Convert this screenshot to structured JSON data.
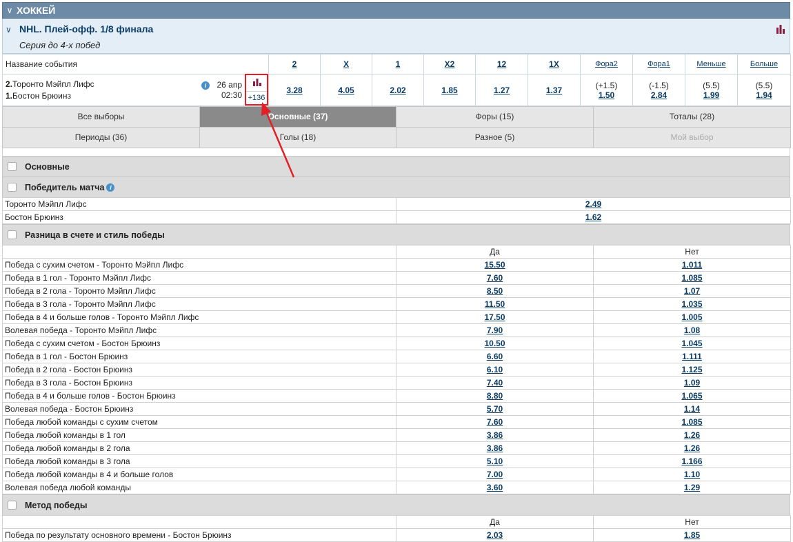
{
  "sport": {
    "title": "ХОККЕЙ"
  },
  "league": {
    "title": "NHL. Плей-офф. 1/8 финала",
    "subtitle": "Серия до 4-х побед"
  },
  "odds_header": {
    "name_label": "Название события",
    "columns": [
      "2",
      "X",
      "1",
      "X2",
      "12",
      "1X",
      "Фора2",
      "Фора1",
      "Меньше",
      "Больше"
    ]
  },
  "event": {
    "team1": "Торонто Мэйпл Лифс",
    "team1_num": "2.",
    "team2": "Бостон Брюинз",
    "team2_num": "1.",
    "date": "26 апр",
    "time": "02:30",
    "more_markets": "+136",
    "odds": [
      "3.28",
      "4.05",
      "2.02",
      "1.85",
      "1.27",
      "1.37"
    ],
    "fora2": {
      "line": "(+1.5)",
      "odd": "1.50"
    },
    "fora1": {
      "line": "(-1.5)",
      "odd": "2.84"
    },
    "under": {
      "line": "(5.5)",
      "odd": "1.99"
    },
    "over": {
      "line": "(5.5)",
      "odd": "1.94"
    }
  },
  "tabs": [
    {
      "label": "Все выборы",
      "state": "normal"
    },
    {
      "label": "Основные (37)",
      "state": "active"
    },
    {
      "label": "Форы (15)",
      "state": "normal"
    },
    {
      "label": "Тоталы (28)",
      "state": "normal"
    },
    {
      "label": "Периоды (36)",
      "state": "normal"
    },
    {
      "label": "Голы (18)",
      "state": "normal"
    },
    {
      "label": "Разное (5)",
      "state": "normal"
    },
    {
      "label": "Мой выбор",
      "state": "disabled"
    }
  ],
  "sections": {
    "main": "Основные",
    "winner": {
      "title": "Победитель матча",
      "rows": [
        {
          "name": "Торонто Мэйпл Лифс",
          "odd": "2.49"
        },
        {
          "name": "Бостон Брюинз",
          "odd": "1.62"
        }
      ]
    },
    "margin": {
      "title": "Разница в счете и стиль победы",
      "col_yes": "Да",
      "col_no": "Нет",
      "rows": [
        {
          "name": "Победа с сухим счетом - Торонто Мэйпл Лифс",
          "yes": "15.50",
          "no": "1.011"
        },
        {
          "name": "Победа в 1 гол - Торонто Мэйпл Лифс",
          "yes": "7.60",
          "no": "1.085"
        },
        {
          "name": "Победа в 2 гола - Торонто Мэйпл Лифс",
          "yes": "8.50",
          "no": "1.07"
        },
        {
          "name": "Победа в 3 гола - Торонто Мэйпл Лифс",
          "yes": "11.50",
          "no": "1.035"
        },
        {
          "name": "Победа в 4 и больше голов - Торонто Мэйпл Лифс",
          "yes": "17.50",
          "no": "1.005"
        },
        {
          "name": "Волевая победа - Торонто Мэйпл Лифс",
          "yes": "7.90",
          "no": "1.08"
        },
        {
          "name": "Победа с сухим счетом - Бостон Брюинз",
          "yes": "10.50",
          "no": "1.045"
        },
        {
          "name": "Победа в 1 гол - Бостон Брюинз",
          "yes": "6.60",
          "no": "1.111"
        },
        {
          "name": "Победа в 2 гола - Бостон Брюинз",
          "yes": "6.10",
          "no": "1.125"
        },
        {
          "name": "Победа в 3 гола - Бостон Брюинз",
          "yes": "7.40",
          "no": "1.09"
        },
        {
          "name": "Победа в 4 и больше голов - Бостон Брюинз",
          "yes": "8.80",
          "no": "1.065"
        },
        {
          "name": "Волевая победа - Бостон Брюинз",
          "yes": "5.70",
          "no": "1.14"
        },
        {
          "name": "Победа любой команды с сухим счетом",
          "yes": "7.60",
          "no": "1.085"
        },
        {
          "name": "Победа любой команды в 1 гол",
          "yes": "3.86",
          "no": "1.26"
        },
        {
          "name": "Победа любой команды в 2 гола",
          "yes": "3.86",
          "no": "1.26"
        },
        {
          "name": "Победа любой команды в 3 гола",
          "yes": "5.10",
          "no": "1.166"
        },
        {
          "name": "Победа любой команды в 4 и больше голов",
          "yes": "7.00",
          "no": "1.10"
        },
        {
          "name": "Волевая победа любой команды",
          "yes": "3.60",
          "no": "1.29"
        }
      ]
    },
    "method": {
      "title": "Метод победы",
      "col_yes": "Да",
      "col_no": "Нет",
      "rows": [
        {
          "name": "Победа по результату основного времени - Бостон Брюинз",
          "yes": "2.03",
          "no": "1.85"
        }
      ]
    }
  },
  "colors": {
    "header_bg": "#6d8ba6",
    "link": "#0b3d66",
    "highlight": "#e31e24",
    "active_tab": "#8a8a8a"
  }
}
